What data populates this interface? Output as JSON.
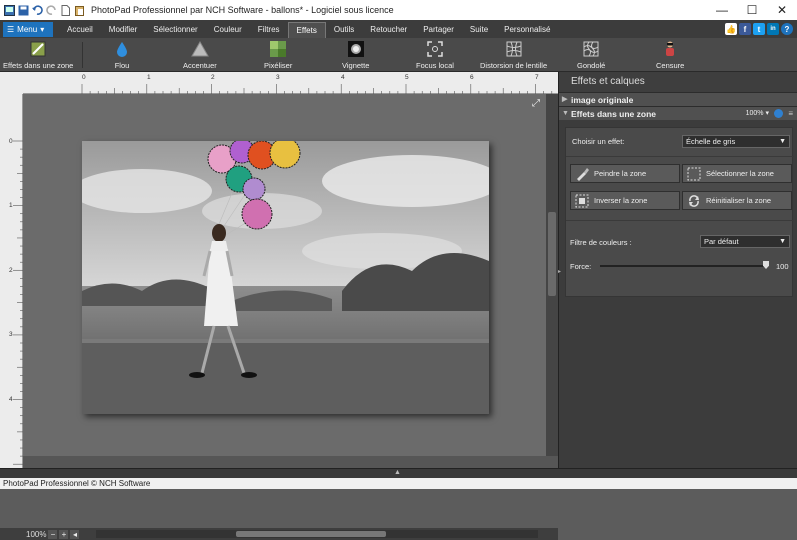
{
  "window": {
    "title": "PhotoPad Professionnel par NCH Software - ballons* - Logiciel sous licence",
    "minimize": "—",
    "maximize": "☐",
    "close": "✕"
  },
  "menu": {
    "button": "Menu",
    "tabs": [
      "Accueil",
      "Modifier",
      "Sélectionner",
      "Couleur",
      "Filtres",
      "Effets",
      "Outils",
      "Retoucher",
      "Partager",
      "Suite",
      "Personnalisé"
    ],
    "active_tab": "Effets"
  },
  "social": [
    "f",
    "t",
    "in",
    "?"
  ],
  "ribbon": {
    "items": [
      "Effets dans une zone",
      "Flou",
      "Accentuer",
      "Pixéliser",
      "Vignette",
      "Focus local",
      "Distorsion de lentille",
      "Gondolé",
      "Censure"
    ]
  },
  "rulers": {
    "h_ticks": [
      "0",
      "1",
      "2",
      "3",
      "4",
      "5",
      "6",
      "7"
    ],
    "v_ticks": [
      "0",
      "1",
      "2",
      "3",
      "4"
    ]
  },
  "status": {
    "zoom": "100%"
  },
  "panel": {
    "title": "Effets et calques",
    "layer_original": "image originale",
    "layer_effect": "Effets dans une zone",
    "layer_zoom": "100%",
    "choose_effect_label": "Choisir un effet:",
    "choose_effect_value": "Échelle de gris",
    "paint_zone": "Peindre la zone",
    "select_zone": "Sélectionner la zone",
    "invert_zone": "Inverser la zone",
    "reset_zone": "Réinitialiser la zone",
    "color_filter_label": "Filtre de couleurs :",
    "color_filter_value": "Par défaut",
    "force_label": "Force:",
    "force_value": "100",
    "force_level": 1.0
  },
  "footer": {
    "text": "PhotoPad Professionnel © NCH Software"
  },
  "colors": {
    "accent": "#1e73be",
    "panel_bg": "#3c3c3c",
    "ribbon_bg": "#4a4a4a"
  }
}
